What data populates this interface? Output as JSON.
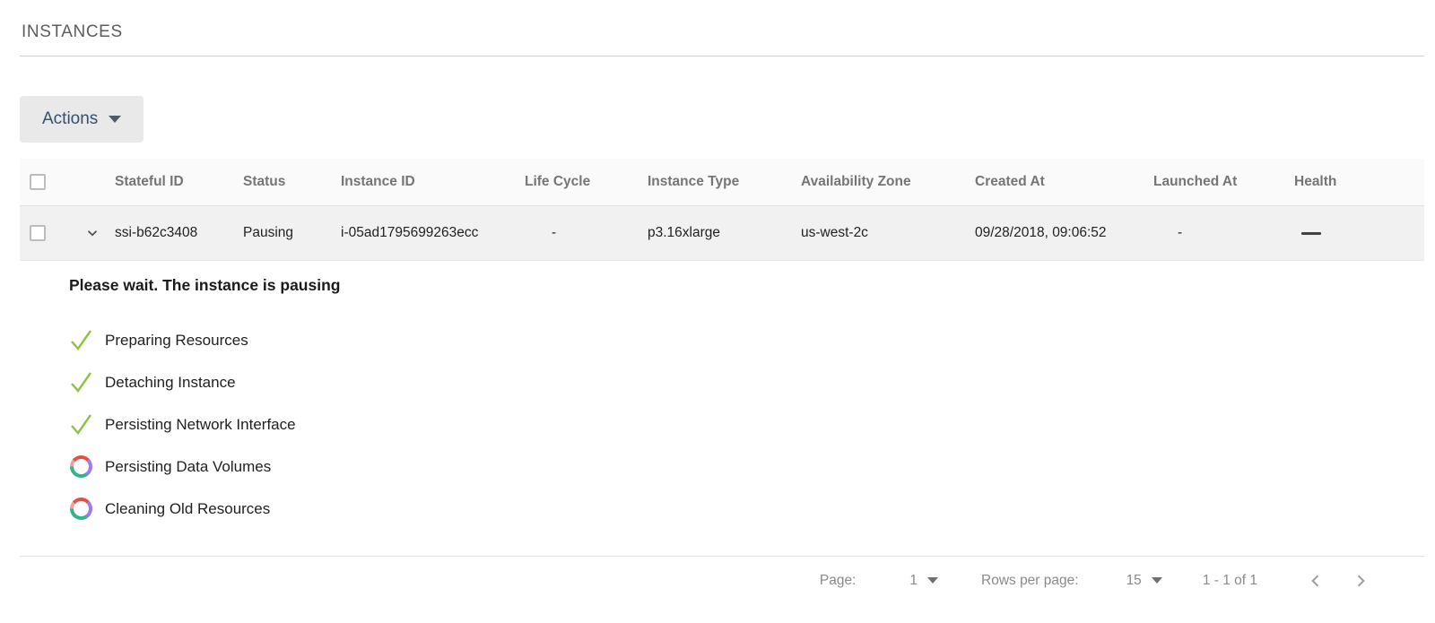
{
  "page": {
    "title": "INSTANCES"
  },
  "toolbar": {
    "actions_label": "Actions"
  },
  "table": {
    "columns": [
      "Stateful ID",
      "Status",
      "Instance ID",
      "Life Cycle",
      "Instance Type",
      "Availability Zone",
      "Created At",
      "Launched At",
      "Health"
    ],
    "row": {
      "stateful_id": "ssi-b62c3408",
      "status": "Pausing",
      "instance_id": "i-05ad1795699263ecc",
      "life_cycle": "-",
      "instance_type": "p3.16xlarge",
      "availability_zone": "us-west-2c",
      "created_at": "09/28/2018, 09:06:52",
      "launched_at": "-",
      "health_icon": "dash-icon"
    }
  },
  "expanded": {
    "title": "Please wait. The instance is pausing",
    "steps": [
      {
        "label": "Preparing Resources",
        "state": "done"
      },
      {
        "label": "Detaching Instance",
        "state": "done"
      },
      {
        "label": "Persisting Network Interface",
        "state": "done"
      },
      {
        "label": "Persisting Data Volumes",
        "state": "in-progress"
      },
      {
        "label": "Cleaning Old Resources",
        "state": "in-progress"
      }
    ]
  },
  "pagination": {
    "page_label": "Page:",
    "page_value": "1",
    "rows_label": "Rows per page:",
    "rows_value": "15",
    "range_text": "1 - 1 of 1"
  },
  "colors": {
    "accent_text": "#33506f",
    "button_bg": "#e9e9e9",
    "header_bg": "#fafafa",
    "row_bg": "#f1f1f1",
    "success_check": "#8bc34a",
    "spinner_red": "#e35045",
    "spinner_purple": "#9b7cf0",
    "spinner_green": "#32b58d",
    "health_dash": "#424242"
  }
}
